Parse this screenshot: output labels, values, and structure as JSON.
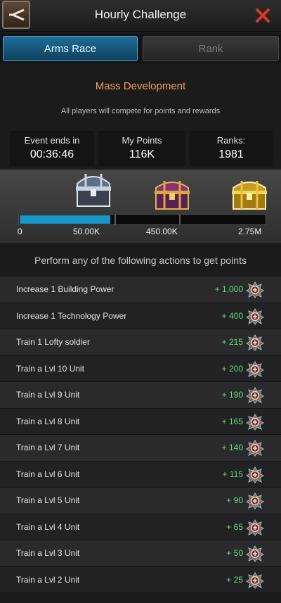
{
  "header": {
    "title": "Hourly Challenge"
  },
  "tabs": [
    {
      "label": "Arms Race",
      "active": true
    },
    {
      "label": "Rank",
      "active": false
    }
  ],
  "event": {
    "name": "Mass Development",
    "subtitle": "All players will compete for points and rewards"
  },
  "stats": [
    {
      "label": "Event ends in",
      "value": "00:36:46"
    },
    {
      "label": "My Points",
      "value": "116K"
    },
    {
      "label": "Ranks:",
      "value": "1981"
    }
  ],
  "progress": {
    "fraction": 0.37,
    "ticks": [
      "0",
      "50.00K",
      "450.00K",
      "2.75M"
    ],
    "chests": [
      "silver-chest-icon",
      "purple-chest-icon",
      "gold-chest-icon"
    ]
  },
  "instructions": "Perform any of the following actions to get points",
  "actions": [
    {
      "label": "Increase 1 Building Power",
      "points": "+ 1,000"
    },
    {
      "label": "Increase 1 Technology Power",
      "points": "+ 400"
    },
    {
      "label": "Train 1 Lofty soldier",
      "points": "+ 215"
    },
    {
      "label": "Train a Lvl 10 Unit",
      "points": "+ 200"
    },
    {
      "label": "Train a Lvl 9 Unit",
      "points": "+ 190"
    },
    {
      "label": "Train a Lvl 8 Unit",
      "points": "+ 165"
    },
    {
      "label": "Train a Lvl 7 Unit",
      "points": "+ 140"
    },
    {
      "label": "Train a Lvl 6 Unit",
      "points": "+ 115"
    },
    {
      "label": "Train a Lvl 5 Unit",
      "points": "+ 90"
    },
    {
      "label": "Train a Lvl 4 Unit",
      "points": "+ 65"
    },
    {
      "label": "Train a Lvl 3 Unit",
      "points": "+ 50"
    },
    {
      "label": "Train a Lvl 2 Unit",
      "points": "+ 25"
    }
  ],
  "colors": {
    "accent": "#1a95c8",
    "event_title": "#f0a05a",
    "points": "#5fe08a",
    "close": "#d8382a"
  }
}
